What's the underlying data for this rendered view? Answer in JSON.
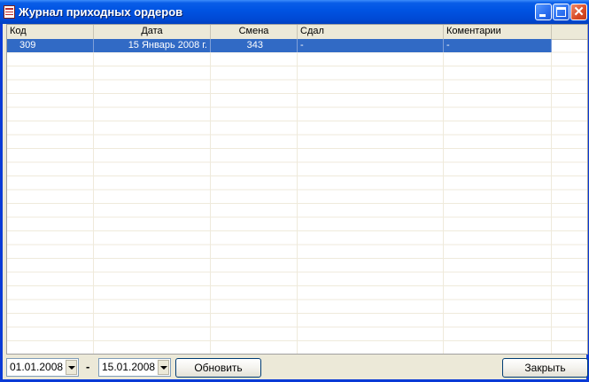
{
  "window": {
    "title": "Журнал приходных ордеров",
    "controls": {
      "minimize": "minimize-icon",
      "maximize": "maximize-icon",
      "close": "close-icon",
      "close_glyph": "✕"
    }
  },
  "grid": {
    "columns": [
      "Код",
      "Дата",
      "Смена",
      "Сдал",
      "Коментарии"
    ],
    "rows": [
      {
        "code": "309",
        "date": "15 Январь 2008 г.",
        "shift": "343",
        "handed_over": "-",
        "comment": "-"
      }
    ],
    "selected_row": 0,
    "colors": {
      "selection": "#316ac5",
      "header": "#ece9d8",
      "gridline": "#efeadb"
    }
  },
  "filter": {
    "date_from": "01.01.2008",
    "separator": "-",
    "date_to": "15.01.2008",
    "refresh_label": "Обновить"
  },
  "footer": {
    "close_label": "Закрыть"
  }
}
